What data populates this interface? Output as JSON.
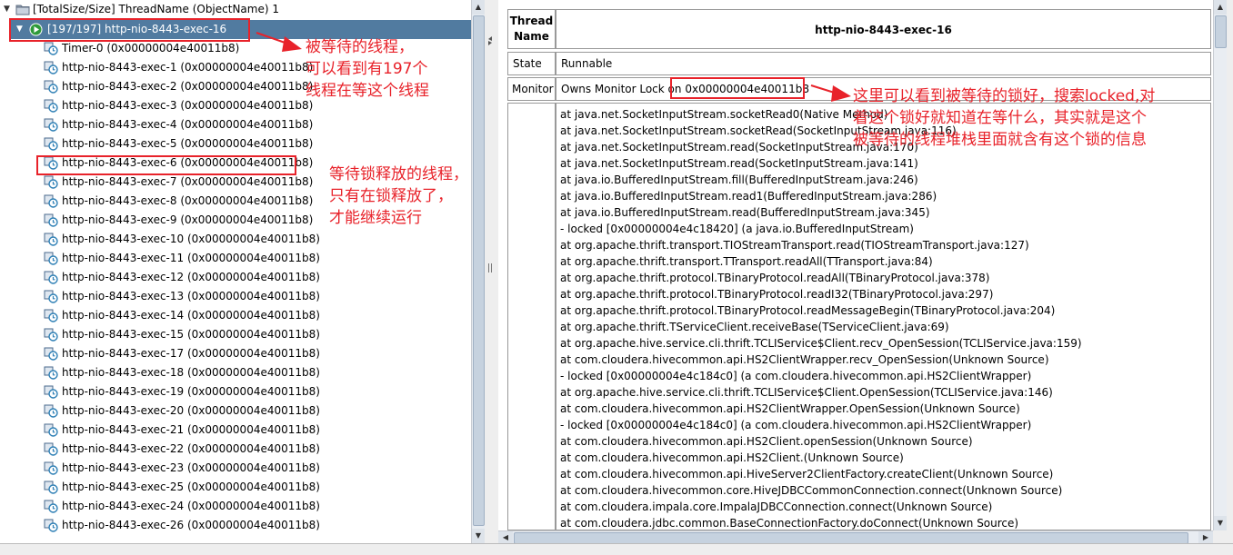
{
  "tree": {
    "root_label": "[TotalSize/Size] ThreadName (ObjectName) 1",
    "selected_label": "[197/197] http-nio-8443-exec-16",
    "children": [
      "Timer-0 (0x00000004e40011b8)",
      "http-nio-8443-exec-1 (0x00000004e40011b8)",
      "http-nio-8443-exec-2 (0x00000004e40011b8)",
      "http-nio-8443-exec-3 (0x00000004e40011b8)",
      "http-nio-8443-exec-4 (0x00000004e40011b8)",
      "http-nio-8443-exec-5 (0x00000004e40011b8)",
      "http-nio-8443-exec-6 (0x00000004e40011b8)",
      "http-nio-8443-exec-7 (0x00000004e40011b8)",
      "http-nio-8443-exec-8 (0x00000004e40011b8)",
      "http-nio-8443-exec-9 (0x00000004e40011b8)",
      "http-nio-8443-exec-10 (0x00000004e40011b8)",
      "http-nio-8443-exec-11 (0x00000004e40011b8)",
      "http-nio-8443-exec-12 (0x00000004e40011b8)",
      "http-nio-8443-exec-13 (0x00000004e40011b8)",
      "http-nio-8443-exec-14 (0x00000004e40011b8)",
      "http-nio-8443-exec-15 (0x00000004e40011b8)",
      "http-nio-8443-exec-17 (0x00000004e40011b8)",
      "http-nio-8443-exec-18 (0x00000004e40011b8)",
      "http-nio-8443-exec-19 (0x00000004e40011b8)",
      "http-nio-8443-exec-20 (0x00000004e40011b8)",
      "http-nio-8443-exec-21 (0x00000004e40011b8)",
      "http-nio-8443-exec-22 (0x00000004e40011b8)",
      "http-nio-8443-exec-23 (0x00000004e40011b8)",
      "http-nio-8443-exec-25 (0x00000004e40011b8)",
      "http-nio-8443-exec-24 (0x00000004e40011b8)",
      "http-nio-8443-exec-26 (0x00000004e40011b8)"
    ]
  },
  "detail": {
    "thread_name_label_1": "Thread",
    "thread_name_label_2": "Name",
    "thread_name_value": "http-nio-8443-exec-16",
    "state_label": "State",
    "state_value": "Runnable",
    "monitor_label": "Monitor",
    "monitor_prefix": "Owns Monitor Lock on",
    "monitor_lock": "0x00000004e40011b8",
    "stack": [
      "at java.net.SocketInputStream.socketRead0(Native Method)",
      "at java.net.SocketInputStream.socketRead(SocketInputStream.java:116)",
      "at java.net.SocketInputStream.read(SocketInputStream.java:170)",
      "at java.net.SocketInputStream.read(SocketInputStream.java:141)",
      "at java.io.BufferedInputStream.fill(BufferedInputStream.java:246)",
      "at java.io.BufferedInputStream.read1(BufferedInputStream.java:286)",
      "at java.io.BufferedInputStream.read(BufferedInputStream.java:345)",
      "- locked [0x00000004e4c18420] (a java.io.BufferedInputStream)",
      "at org.apache.thrift.transport.TIOStreamTransport.read(TIOStreamTransport.java:127)",
      "at org.apache.thrift.transport.TTransport.readAll(TTransport.java:84)",
      "at org.apache.thrift.protocol.TBinaryProtocol.readAll(TBinaryProtocol.java:378)",
      "at org.apache.thrift.protocol.TBinaryProtocol.readI32(TBinaryProtocol.java:297)",
      "at org.apache.thrift.protocol.TBinaryProtocol.readMessageBegin(TBinaryProtocol.java:204)",
      "at org.apache.thrift.TServiceClient.receiveBase(TServiceClient.java:69)",
      "at org.apache.hive.service.cli.thrift.TCLIService$Client.recv_OpenSession(TCLIService.java:159)",
      "at com.cloudera.hivecommon.api.HS2ClientWrapper.recv_OpenSession(Unknown Source)",
      "- locked [0x00000004e4c184c0] (a com.cloudera.hivecommon.api.HS2ClientWrapper)",
      "at org.apache.hive.service.cli.thrift.TCLIService$Client.OpenSession(TCLIService.java:146)",
      "at com.cloudera.hivecommon.api.HS2ClientWrapper.OpenSession(Unknown Source)",
      "- locked [0x00000004e4c184c0] (a com.cloudera.hivecommon.api.HS2ClientWrapper)",
      "at com.cloudera.hivecommon.api.HS2Client.openSession(Unknown Source)",
      "at com.cloudera.hivecommon.api.HS2Client.(Unknown Source)",
      "at com.cloudera.hivecommon.api.HiveServer2ClientFactory.createClient(Unknown Source)",
      "at com.cloudera.hivecommon.core.HiveJDBCCommonConnection.connect(Unknown Source)",
      "at com.cloudera.impala.core.ImpalaJDBCConnection.connect(Unknown Source)",
      "at com.cloudera.jdbc.common.BaseConnectionFactory.doConnect(Unknown Source)"
    ]
  },
  "annotations": {
    "note1": [
      "被等待的线程，",
      "可以看到有197个",
      "线程在等这个线程"
    ],
    "note2": [
      "等待锁释放的线程，",
      "只有在锁释放了，",
      "才能继续运行"
    ],
    "note3": [
      "这里可以看到被等待的锁好，搜索locked,对",
      "着这个锁好就知道在等什么，其实就是这个",
      "被等待的线程堆栈里面就含有这个锁的信息"
    ]
  },
  "colors": {
    "selection": "#517ba0",
    "annotation": "#e8222a"
  },
  "icons": [
    "folder-icon",
    "thread-run-icon",
    "thread-wait-icon",
    "expand-arrow-icon"
  ]
}
